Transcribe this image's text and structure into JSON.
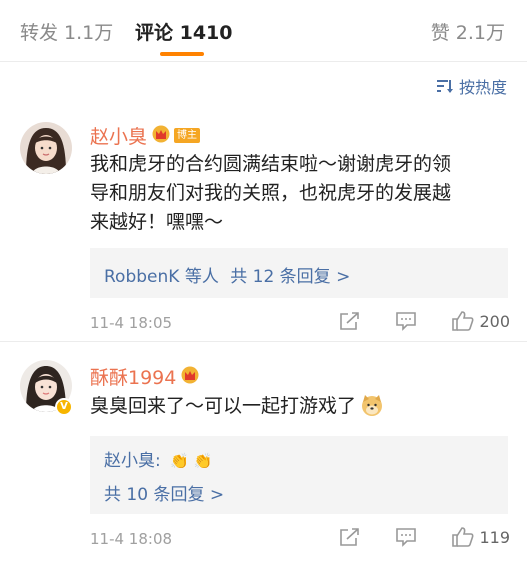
{
  "tabs": {
    "repost": "转发 1.1万",
    "comments": "评论 1410",
    "likes": "赞 2.1万"
  },
  "sort_label": "按热度",
  "comments": [
    {
      "name": "赵小臭",
      "badge": "博主",
      "lines": [
        "我和虎牙的合约圆满结束啦～谢谢虎牙的领",
        "导和朋友们对我的关照，也祝虎牙的发展越",
        "来越好！嘿嘿～"
      ],
      "reply_users": "RobbenK 等人",
      "reply_count": "共 12 条回复 >",
      "time": "11-4 18:05",
      "likes": "200"
    },
    {
      "name": "酥酥1994",
      "lines": [
        "臭臭回来了～可以一起打游戏了"
      ],
      "reply_name": "赵小臭:",
      "reply_emoji": "👏 👏",
      "reply_count": "共 10 条回复 >",
      "time": "11-4 18:08",
      "likes": "119"
    }
  ],
  "colors": {
    "accent": "#ff8200",
    "username": "#eb7350",
    "link": "#4a6fa5",
    "muted": "#a0a0a0"
  }
}
